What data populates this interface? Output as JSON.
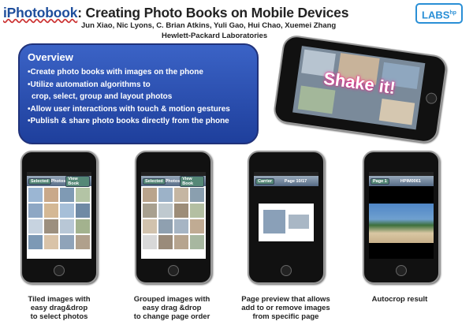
{
  "header": {
    "title_brand": "iPhotobook",
    "title_rest": ": Creating Photo Books on Mobile Devices",
    "authors": "Jun Xiao, Nic Lyons, C. Brian Atkins, Yuli Gao, Hui Chao, Xuemei Zhang",
    "affiliation": "Hewlett-Packard Laboratories",
    "logo_text": "LABS",
    "logo_super": "hp"
  },
  "overview": {
    "heading": "Overview",
    "lines": [
      "•Create photo books with images on the phone",
      "•Utilize automation algorithms to",
      "crop, select, group and layout photos",
      "•Allow user interactions with touch & motion gestures",
      "•Publish & share photo books directly from the phone"
    ]
  },
  "shake_phone": {
    "text": "Shake it!"
  },
  "phones": [
    {
      "nav_left": "Selected",
      "nav_title": "Photos",
      "nav_right": "View Book",
      "caption": [
        "Tiled images with",
        "easy drag&drop",
        "to select photos"
      ]
    },
    {
      "nav_left": "Selected",
      "nav_title": "Photos",
      "nav_right": "View Book",
      "caption": [
        "Grouped images with",
        "easy drag &drop",
        "to change page order"
      ]
    },
    {
      "nav_left": "Carrier",
      "nav_title": "Page 10/17",
      "nav_right": "",
      "caption": [
        "Page preview that allows",
        "add to or remove images",
        "from specific page"
      ]
    },
    {
      "nav_left": "Page 1",
      "nav_title": "HPIM0061",
      "nav_right": "",
      "caption": [
        "Autocrop result"
      ]
    }
  ],
  "colors": {
    "overview_bg": "#2f56b8",
    "title_brand": "#1e4e9c",
    "logo": "#2a8fd6"
  }
}
